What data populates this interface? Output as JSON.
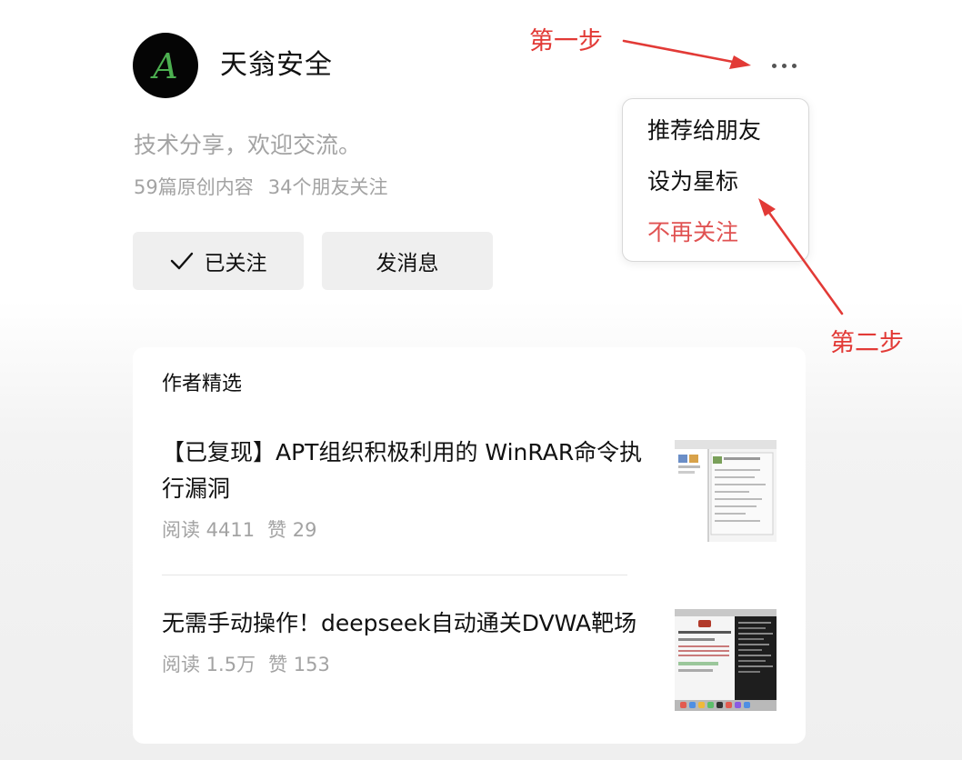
{
  "account": {
    "avatar_letter": "A",
    "name": "天翁安全",
    "bio": "技术分享，欢迎交流。",
    "original_count": "59篇原创内容",
    "friends_following": "34个朋友关注"
  },
  "actions": {
    "followed_label": "已关注",
    "message_label": "发消息",
    "more_icon": "more-dots-icon"
  },
  "menu": {
    "items": [
      {
        "label": "推荐给朋友"
      },
      {
        "label": "设为星标"
      },
      {
        "label": "不再关注"
      }
    ]
  },
  "featured": {
    "title": "作者精选",
    "articles": [
      {
        "title": "【已复现】APT组织积极利用的 WinRAR命令执行漏洞",
        "reads": "阅读 4411",
        "likes": "赞 29"
      },
      {
        "title": "无需手动操作！deepseek自动通关DVWA靶场",
        "reads": "阅读 1.5万",
        "likes": "赞 153"
      }
    ]
  },
  "annotations": {
    "step1": "第一步",
    "step2": "第二步",
    "color": "#e23a36"
  },
  "colors": {
    "accent_red": "#e05252",
    "muted_text": "#a3a3a3",
    "avatar_letter": "#4caf50"
  }
}
